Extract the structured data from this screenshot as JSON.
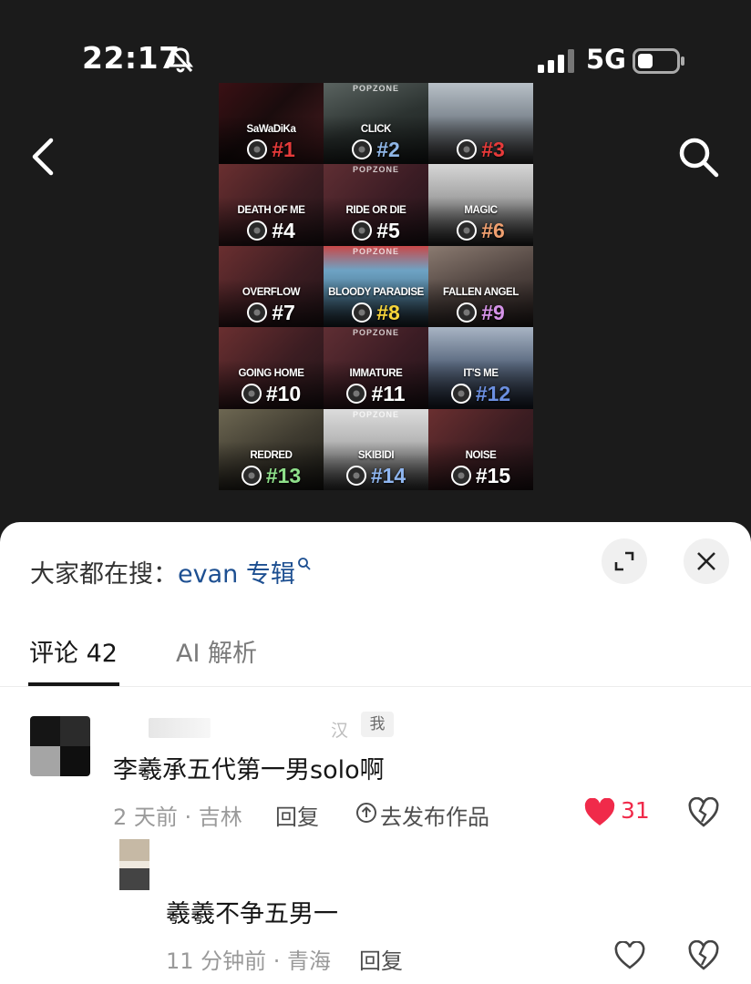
{
  "status_bar": {
    "time": "22:17",
    "network": "5G"
  },
  "grid_tiles": [
    {
      "song": "SaWaDiKa",
      "rank": "#1",
      "rank_color": "#e63a3a",
      "popzone": "",
      "photo": "linear-gradient(135deg,#3a1014 0%,#1a0c0d 45%,#4a1c20 100%)"
    },
    {
      "song": "CLICK",
      "rank": "#2",
      "rank_color": "#8fb6e6",
      "popzone": "POPZONE",
      "photo": "linear-gradient(160deg,#5a6360 0%,#2c3331 50%,#1a1e1d 100%)"
    },
    {
      "song": "",
      "rank": "#3",
      "rank_color": "#e83a3a",
      "popzone": "",
      "photo": "linear-gradient(180deg,#b8c0c7 0%,#7e8790 45%,#3a3838 100%)"
    },
    {
      "song": "DEATH OF ME",
      "rank": "#4",
      "rank_color": "#ffffff",
      "popzone": "",
      "photo": "linear-gradient(135deg,#6a2f30 0%,#3c1d22 55%,#241519 100%)"
    },
    {
      "song": "RIDE OR DIE",
      "rank": "#5",
      "rank_color": "#ffffff",
      "popzone": "POPZONE",
      "photo": "linear-gradient(135deg,#5f2e33 0%,#3b1c24 55%,#23141a 100%)"
    },
    {
      "song": "MAGIC",
      "rank": "#6",
      "rank_color": "#f0a070",
      "popzone": "",
      "photo": "linear-gradient(180deg,#d6d6d6 0%,#9a9a9a 50%,#2a2a2a 100%)"
    },
    {
      "song": "OVERFLOW",
      "rank": "#7",
      "rank_color": "#ffffff",
      "popzone": "",
      "photo": "linear-gradient(135deg,#6a2f30 0%,#3c1d22 55%,#241519 100%)"
    },
    {
      "song": "BLOODY PARADISE",
      "rank": "#8",
      "rank_color": "#f6d43a",
      "popzone": "POPZONE",
      "photo": "linear-gradient(180deg,#c84848 0%,#6ea3c4 30%,#4f7c97 60%,#1f2a33 100%)"
    },
    {
      "song": "FALLEN ANGEL",
      "rank": "#9",
      "rank_color": "#d593e8",
      "popzone": "",
      "photo": "linear-gradient(160deg,#8a7a70 0%,#4f433f 50%,#2a2120 100%)"
    },
    {
      "song": "GOING HOME",
      "rank": "#10",
      "rank_color": "#ffffff",
      "popzone": "",
      "photo": "linear-gradient(135deg,#6a2f30 0%,#3c1d22 55%,#241519 100%)"
    },
    {
      "song": "IMMATURE",
      "rank": "#11",
      "rank_color": "#ffffff",
      "popzone": "POPZONE",
      "photo": "linear-gradient(135deg,#5f2e33 0%,#3b1c24 55%,#23141a 100%)"
    },
    {
      "song": "IT'S ME",
      "rank": "#12",
      "rank_color": "#6b8fe0",
      "popzone": "",
      "photo": "linear-gradient(180deg,#a8b4c4 0%,#5b6a80 45%,#1e2533 100%)"
    },
    {
      "song": "REDRED",
      "rank": "#13",
      "rank_color": "#8fe08a",
      "popzone": "",
      "photo": "linear-gradient(150deg,#6d6752 0%,#3f3b30 50%,#1b1a16 100%)"
    },
    {
      "song": "SKIBIDI",
      "rank": "#14",
      "rank_color": "#8fb6f0",
      "popzone": "POPZONE",
      "photo": "linear-gradient(180deg,#dcdcdc 0%,#a8a8a8 55%,#444 100%)"
    },
    {
      "song": "NOISE",
      "rank": "#15",
      "rank_color": "#ffffff",
      "popzone": "",
      "photo": "linear-gradient(135deg,#6a2f30 0%,#3c1d22 55%,#241519 100%)"
    }
  ],
  "sheet": {
    "trend_prefix": "大家都在搜：",
    "trend_keyword": "evan 专辑",
    "tabs": [
      {
        "label": "评论 42"
      },
      {
        "label": "AI 解析"
      }
    ],
    "comments": [
      {
        "me_badge": "我",
        "name_fragment": "汉",
        "text": "李羲承五代第一男solo啊",
        "time_location": "2 天前 · 吉林",
        "reply_label": "回复",
        "publish_label": "去发布作品",
        "likes": "31"
      },
      {
        "text": "羲羲不争五男一",
        "time_location": "11 分钟前 · 青海",
        "reply_label": "回复"
      }
    ]
  },
  "colors": {
    "like_red": "#f02a4a",
    "keyword_blue": "#1d4f91"
  }
}
